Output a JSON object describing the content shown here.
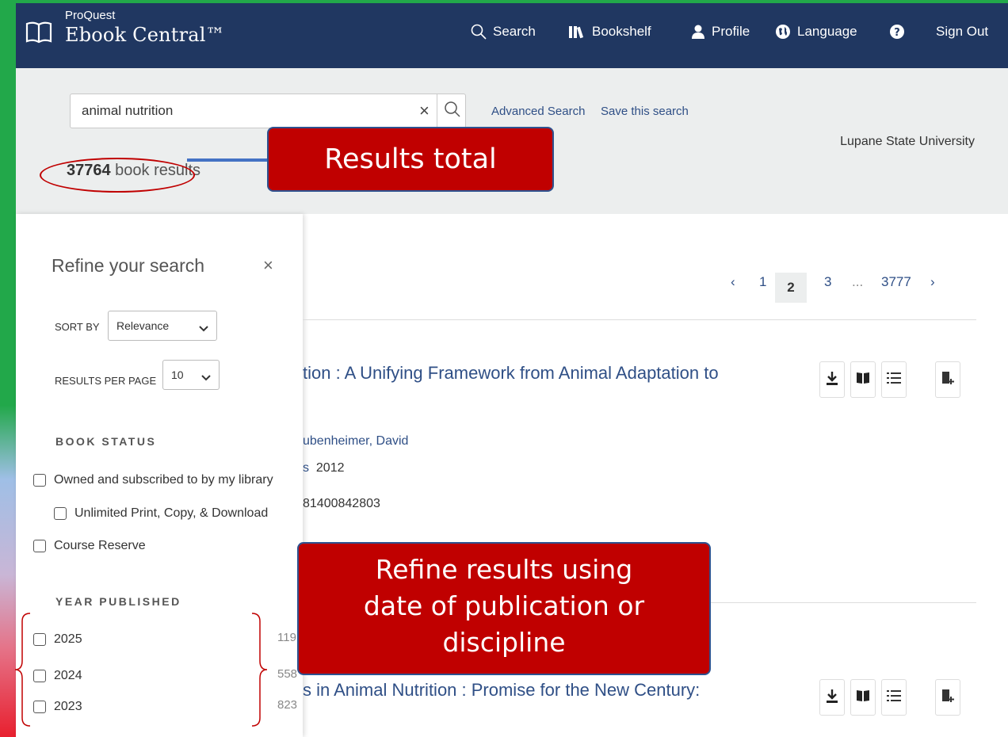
{
  "header": {
    "brand_small": "ProQuest",
    "brand_big": "Ebook Central™",
    "nav": {
      "search": "Search",
      "bookshelf": "Bookshelf",
      "profile": "Profile",
      "language": "Language",
      "sign_out": "Sign Out"
    }
  },
  "search": {
    "query": "animal nutrition",
    "clear_symbol": "×",
    "advanced_search": "Advanced Search",
    "save_search": "Save this search",
    "institution": "Lupane State University",
    "results_number": "37764",
    "results_suffix": " book results"
  },
  "annotations": {
    "results_total": "Results total",
    "refine_line1": "Refine results using",
    "refine_line2": "date of publication or",
    "refine_line3": "discipline",
    "accent_color": "#c00000",
    "arrow_color": "#4472c4"
  },
  "sidebar": {
    "title": "Refine your search",
    "close_symbol": "×",
    "sort_by_label": "SORT BY",
    "sort_by_value": "Relevance",
    "per_page_label": "RESULTS PER PAGE",
    "per_page_value": "10",
    "book_status_head": "BOOK STATUS",
    "book_status": [
      "Owned and subscribed to by my library",
      "Unlimited Print, Copy, & Download",
      "Course Reserve"
    ],
    "year_head": "YEAR PUBLISHED",
    "years": [
      {
        "label": "2025",
        "count": "119"
      },
      {
        "label": "2024",
        "count": "558"
      },
      {
        "label": "2023",
        "count": "823"
      }
    ]
  },
  "pager": {
    "prev": "‹",
    "p1": "1",
    "p2": "2",
    "p3": "3",
    "ellipsis": "...",
    "last": "3777",
    "next": "›"
  },
  "results": [
    {
      "title_visible": "tion : A Unifying Framework from Animal Adaptation to",
      "author_visible": "ubenheimer, David",
      "publisher_year_visible": "s",
      "year": "2012",
      "isbn_visible": "81400842803"
    },
    {
      "title_visible": "s in Animal Nutrition : Promise for the New Century:"
    }
  ],
  "colors": {
    "header_bg": "#203761",
    "band_bg": "#eceeee",
    "link": "#2f4f86"
  }
}
